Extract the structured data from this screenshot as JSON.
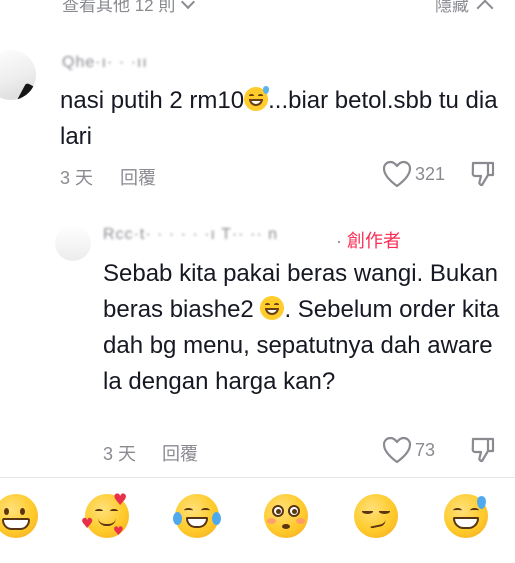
{
  "top": {
    "view_more": "查看其他 12 則",
    "hide": "隱藏"
  },
  "comments": [
    {
      "text_before": "nasi putih 2 rm10",
      "text_after": "...biar betol.sbb tu dia lari",
      "date": "3 天",
      "reply_label": "回覆",
      "likes": "321"
    },
    {
      "creator_label": "創作者",
      "text_before": "Sebab kita pakai beras wangi. Bukan beras biashe2 ",
      "text_after": ". Sebelum order kita dah bg menu, sepatutnya dah aware la dengan harga kan?",
      "date": "3 天",
      "reply_label": "回覆",
      "likes": "73"
    }
  ],
  "emoji_bar": [
    {
      "name": "grinning-face-icon"
    },
    {
      "name": "smiling-face-with-hearts-icon"
    },
    {
      "name": "face-with-tears-of-joy-icon"
    },
    {
      "name": "flushed-face-icon"
    },
    {
      "name": "smirking-face-icon"
    },
    {
      "name": "grinning-sweat-face-icon"
    }
  ],
  "colors": {
    "text": "#161823",
    "muted": "#8a8b91",
    "creator_accent": "#fe2c55"
  }
}
